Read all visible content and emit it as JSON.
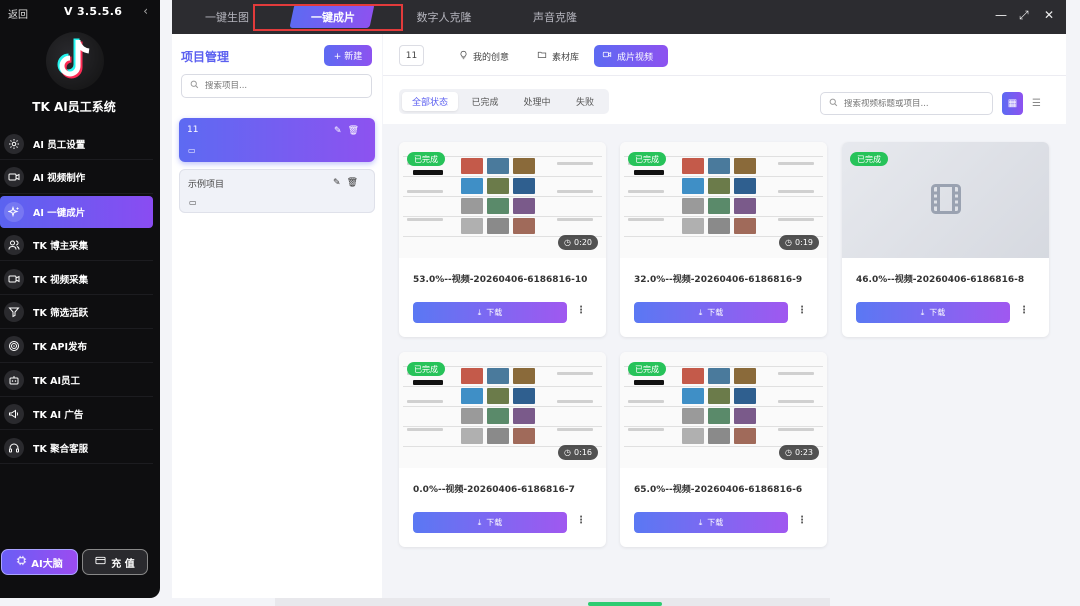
{
  "sidebar": {
    "back_label": "返回",
    "version": "V 3.5.5.6",
    "app_name": "TK AI员工系统",
    "items": [
      {
        "label": "AI 员工设置",
        "icon": "gear-icon"
      },
      {
        "label": "AI 视频制作",
        "icon": "video-camera-icon"
      },
      {
        "label": "AI 一键成片",
        "icon": "sparkles-icon"
      },
      {
        "label": "TK 博主采集",
        "icon": "users-icon"
      },
      {
        "label": "TK 视频采集",
        "icon": "video-camera-icon"
      },
      {
        "label": "TK 筛选活跃",
        "icon": "funnel-icon"
      },
      {
        "label": "TK API发布",
        "icon": "target-icon"
      },
      {
        "label": "TK AI员工",
        "icon": "robot-icon"
      },
      {
        "label": "TK AI 广告",
        "icon": "megaphone-icon"
      },
      {
        "label": "TK 聚合客服",
        "icon": "headset-icon"
      }
    ],
    "active_index": 2,
    "brain_label": "AI大脑",
    "charge_label": "充 值"
  },
  "topbar": {
    "tabs": [
      "一键生图",
      "一键成片",
      "数字人克隆",
      "声音克隆"
    ],
    "active_tab": 1
  },
  "projects": {
    "title": "项目管理",
    "new_label": "+ 新建",
    "search_placeholder": "搜索项目...",
    "items": [
      {
        "name": "11"
      },
      {
        "name": "示例项目"
      }
    ]
  },
  "toolbar": {
    "project_id": "11",
    "buttons": [
      "我的创意",
      "素材库",
      "成片视频"
    ],
    "active_button": 2
  },
  "filters": {
    "items": [
      "全部状态",
      "已完成",
      "处理中",
      "失败"
    ],
    "active": 0,
    "search_placeholder": "搜索视频标题或项目..."
  },
  "videos": [
    {
      "status": "已完成",
      "duration": "0:20",
      "title": "53.0%--视频-20260406-6186816-10",
      "download": "下载",
      "has_thumb": true
    },
    {
      "status": "已完成",
      "duration": "0:19",
      "title": "32.0%--视频-20260406-6186816-9",
      "download": "下载",
      "has_thumb": true
    },
    {
      "status": "已完成",
      "duration": "",
      "title": "46.0%--视频-20260406-6186816-8",
      "download": "下载",
      "has_thumb": false
    },
    {
      "status": "已完成",
      "duration": "0:16",
      "title": "0.0%--视频-20260406-6186816-7",
      "download": "下载",
      "has_thumb": true
    },
    {
      "status": "已完成",
      "duration": "0:23",
      "title": "65.0%--视频-20260406-6186816-6",
      "download": "下载",
      "has_thumb": true
    }
  ],
  "colors": {
    "accent": "#5d6af2",
    "accent2": "#8d52f0",
    "success": "#27c35a",
    "highlight": "#e23b3b"
  }
}
